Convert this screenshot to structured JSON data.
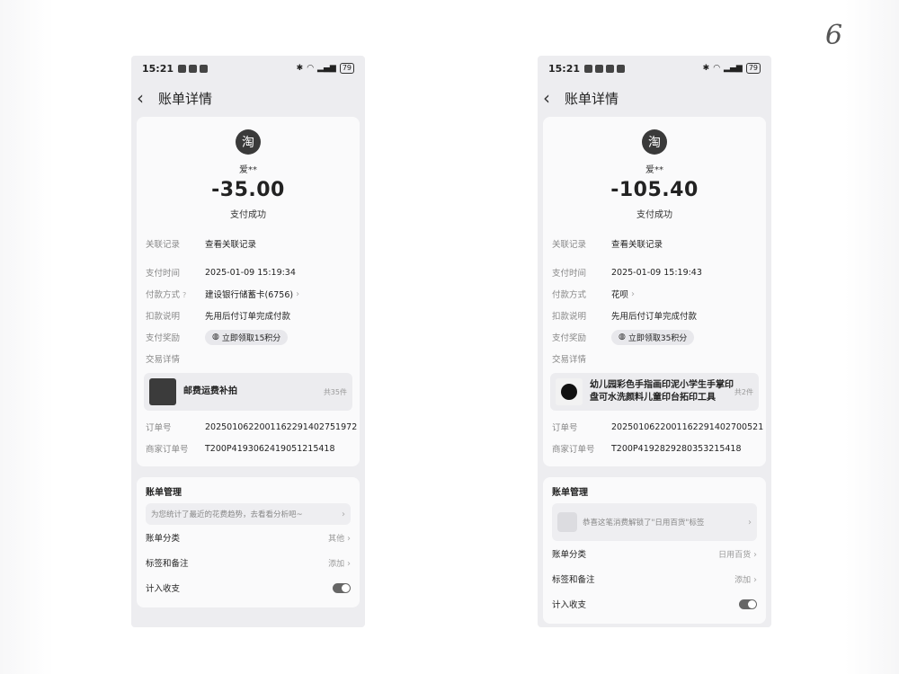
{
  "page_mark": "6",
  "screens": [
    {
      "time": "15:21",
      "battery": "79",
      "title": "账单详情",
      "merchant_logo": "淘",
      "merchant": "爱**",
      "amount": "-35.00",
      "status": "支付成功",
      "related_label": "关联记录",
      "related_value": "查看关联记录",
      "pay_time_label": "支付时间",
      "pay_time_value": "2025-01-09 15:19:34",
      "method_label": "付款方式",
      "method_value": "建设银行储蓄卡(6756)",
      "deduct_label": "扣款说明",
      "deduct_value": "先用后付订单完成付款",
      "reward_label": "支付奖励",
      "reward_value": "立即领取15积分",
      "detail_label": "交易详情",
      "product_name": "邮费运费补拍",
      "product_count": "共35件",
      "order_label": "订单号",
      "order_value": "2025010622001162291402751972",
      "merchant_order_label": "商家订单号",
      "merchant_order_value": "T200P4193062419051215418",
      "mgmt_title": "账单管理",
      "tip_text": "为您统计了最近的花费趋势，去看看分析吧~",
      "category_label": "账单分类",
      "category_value": "其他",
      "tags_label": "标签和备注",
      "tags_value": "添加",
      "income_label": "计入收支"
    },
    {
      "time": "15:21",
      "battery": "79",
      "title": "账单详情",
      "merchant_logo": "淘",
      "merchant": "爱**",
      "amount": "-105.40",
      "status": "支付成功",
      "related_label": "关联记录",
      "related_value": "查看关联记录",
      "pay_time_label": "支付时间",
      "pay_time_value": "2025-01-09 15:19:43",
      "method_label": "付款方式",
      "method_value": "花呗",
      "deduct_label": "扣款说明",
      "deduct_value": "先用后付订单完成付款",
      "reward_label": "支付奖励",
      "reward_value": "立即领取35积分",
      "detail_label": "交易详情",
      "product_name": "幼儿园彩色手指画印泥小学生手掌印盘可水洗颜料儿童印台拓印工具",
      "product_count": "共2件",
      "order_label": "订单号",
      "order_value": "2025010622001162291402700521",
      "merchant_order_label": "商家订单号",
      "merchant_order_value": "T200P4192829280353215418",
      "mgmt_title": "账单管理",
      "tip_text": "恭喜这笔消费解锁了\"日用百货\"标签",
      "category_label": "账单分类",
      "category_value": "日用百货",
      "tags_label": "标签和备注",
      "tags_value": "添加",
      "income_label": "计入收支"
    }
  ]
}
